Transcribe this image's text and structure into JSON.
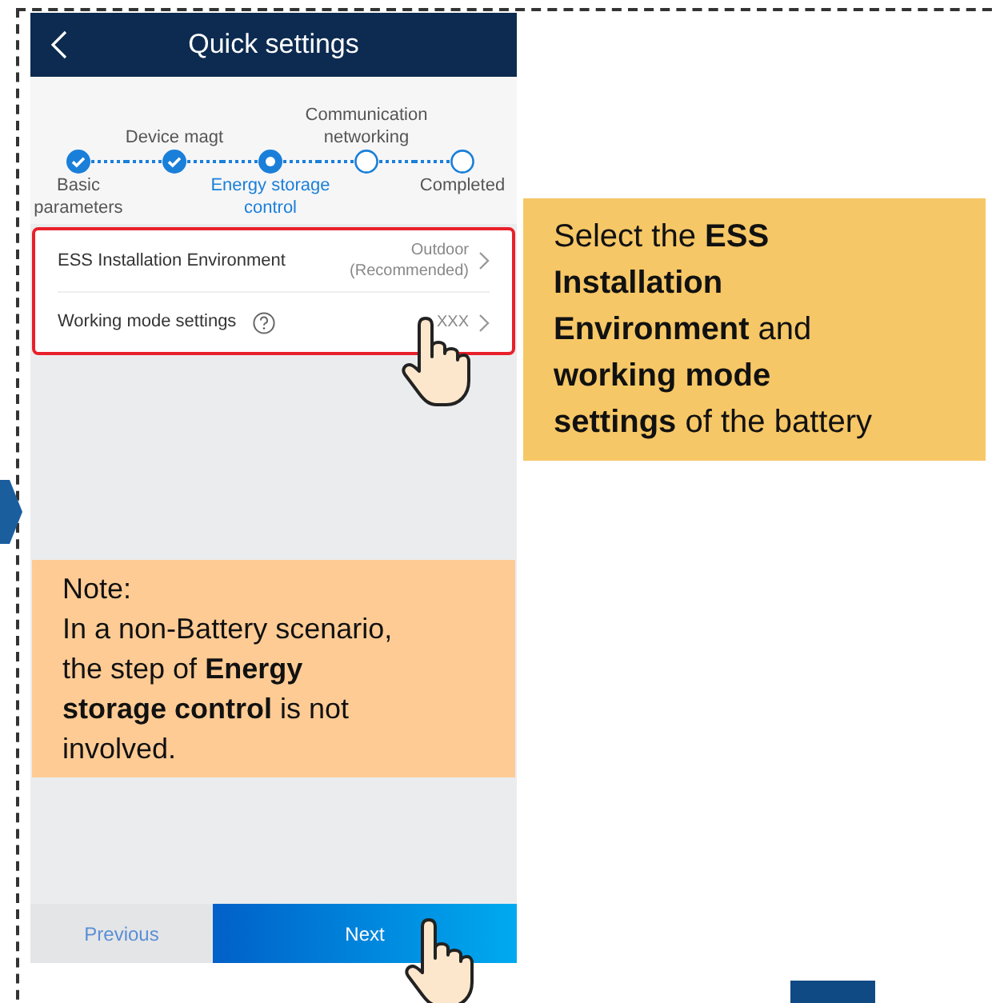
{
  "header": {
    "title": "Quick settings"
  },
  "steps": [
    {
      "label": "Basic parameters",
      "kind": "done",
      "selected": false
    },
    {
      "label": "Device magt",
      "kind": "done",
      "selected": false
    },
    {
      "label": "Energy storage control",
      "kind": "current",
      "selected": true
    },
    {
      "label": "Communication networking",
      "kind": "pending",
      "selected": false
    },
    {
      "label": "Completed",
      "kind": "pending",
      "selected": false
    }
  ],
  "settings": [
    {
      "label": "ESS Installation Environment",
      "value": "Outdoor (Recommended)",
      "help": false
    },
    {
      "label": "Working mode settings",
      "value": "XXX",
      "help": true
    }
  ],
  "buttons": [
    {
      "label": "Previous",
      "kind": "secondary"
    },
    {
      "label": "Next",
      "kind": "primary"
    }
  ],
  "callout": "Select the **ESS Installation Environment** and **working mode settings** of the battery",
  "note": {
    "title": "Note:",
    "text": "In a non-Battery scenario, the step of **Energy storage control** is not involved."
  }
}
